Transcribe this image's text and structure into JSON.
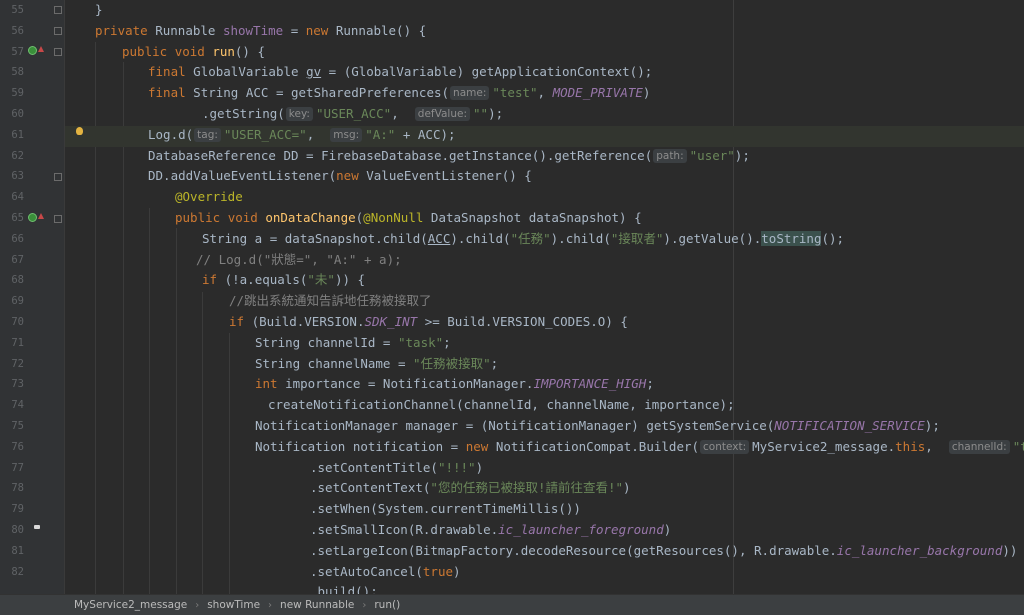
{
  "line_numbers": [
    "55",
    "56",
    "57",
    "58",
    "59",
    "60",
    "61",
    "62",
    "63",
    "64",
    "65",
    "66",
    "67",
    "68",
    "69",
    "70",
    "71",
    "72",
    "73",
    "74",
    "75",
    "76",
    "77",
    "78",
    "79",
    "80",
    "81",
    "82"
  ],
  "code": {
    "l55": "}",
    "l56": {
      "kw1": "private",
      "rest": " Runnable ",
      "name": "showTime",
      "eq": " = ",
      "kw2": "new",
      "tail": " Runnable() {"
    },
    "l57": {
      "kw1": "public",
      "kw2": "void",
      "fn": "run",
      "tail": "() {"
    },
    "l58": {
      "kw1": "final",
      "mid": " GlobalVariable ",
      "var": "gv",
      "rest": " = (GlobalVariable) getApplicationContext();"
    },
    "l59": {
      "kw1": "final",
      "mid": " String ACC = getSharedPreferences(",
      "hint": "name:",
      "str": "\"test\"",
      "rest": ", ",
      "const": "MODE_PRIVATE",
      "tail": ")"
    },
    "l60": {
      "pre": ".getString(",
      "hint1": "key:",
      "str1": "\"USER_ACC\"",
      "sep": ",  ",
      "hint2": "defValue:",
      "str2": "\"\"",
      "tail": ");"
    },
    "l61": {
      "pre": "Log.d(",
      "hint1": "tag:",
      "str1": "\"USER_ACC=\"",
      "sep": ",  ",
      "hint2": "msg:",
      "str2": "\"A:\"",
      "tail": " + ACC);"
    },
    "l62": {
      "pre": "DatabaseReference DD = FirebaseDatabase.getInstance().getReference(",
      "hint": "path:",
      "str": "\"user\"",
      "tail": ");"
    },
    "l63": {
      "pre": "DD.addValueEventListener(",
      "kw": "new",
      "tail": " ValueEventListener() {"
    },
    "l64": "@Override",
    "l65": {
      "kw1": "public",
      "kw2": "void",
      "fn": "onDataChange",
      "ann": "@NonNull",
      "tail": " DataSnapshot dataSnapshot) {"
    },
    "l66": {
      "pre": "String a = dataSnapshot.child(",
      "acc": "ACC",
      "m1": ").child(",
      "s1": "\"任務\"",
      "m2": ").child(",
      "s2": "\"接取者\"",
      "m3": ").getValue().",
      "ts": "toString",
      "tail": "();"
    },
    "l67": "// Log.d(\"狀態=\", \"A:\" + a);",
    "l68": {
      "kw": "if",
      "pre": " (!a.equals(",
      "str": "\"未\"",
      "tail": ")) {"
    },
    "l69": "//跳出系統通知告訴地任務被接取了",
    "l70": {
      "kw": "if",
      "pre": " (Build.VERSION.",
      "c": "SDK_INT",
      "tail": " >= Build.VERSION_CODES.O) {"
    },
    "l71": {
      "pre": "String channelId = ",
      "str": "\"task\"",
      "tail": ";"
    },
    "l72": {
      "pre": "String channelName = ",
      "str": "\"任務被接取\"",
      "tail": ";"
    },
    "l73": {
      "kw": "int",
      "pre": " importance = NotificationManager.",
      "c": "IMPORTANCE_HIGH",
      "tail": ";"
    },
    "l74": "createNotificationChannel(channelId, channelName, importance);",
    "l75": {
      "pre": "NotificationManager manager = (NotificationManager) getSystemService(",
      "c": "NOTIFICATION_SERVICE",
      "tail": ");"
    },
    "l76": {
      "pre": "Notification notification = ",
      "kw": "new",
      "mid": " NotificationCompat.Builder(",
      "hint1": "context:",
      "m2": "MyService2_message.",
      "kw2": "this",
      "sep": ",  ",
      "hint2": "channelId:",
      "str": "\"task\"",
      "tail": ")"
    },
    "l77": {
      "pre": ".setContentTitle(",
      "str": "\"!!!\"",
      "tail": ")"
    },
    "l78": {
      "pre": ".setContentText(",
      "str": "\"您的任務已被接取!請前往查看!\"",
      "tail": ")"
    },
    "l79": ".setWhen(System.currentTimeMillis())",
    "l80": {
      "pre": ".setSmallIcon(R.drawable.",
      "c": "ic_launcher_foreground",
      "tail": ")"
    },
    "l81": {
      "pre": ".setLargeIcon(BitmapFactory.decodeResource(getResources(), R.drawable.",
      "c": "ic_launcher_background",
      "tail": "))"
    },
    "l82": {
      "pre": ".setAutoCancel(",
      "kw": "true",
      "tail": ")"
    },
    "l83": ".build();"
  },
  "breadcrumb": [
    "MyService2_message",
    "showTime",
    "new Runnable",
    "run()"
  ],
  "colors": {
    "background": "#2b2b2b",
    "gutter": "#313335",
    "keyword": "#cc7832",
    "function": "#ffc66d",
    "string": "#6a8759",
    "constant": "#9876aa",
    "annotation": "#bbb529",
    "comment": "#808080",
    "text": "#a9b7c6"
  }
}
